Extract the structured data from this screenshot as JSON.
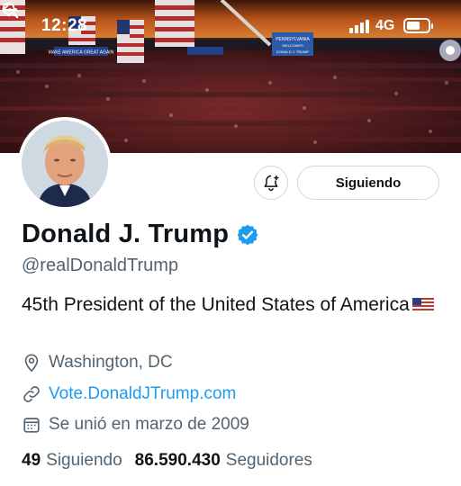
{
  "status_bar": {
    "time": "12:28",
    "network": "4G"
  },
  "banner": {
    "sign_left": "MAKE AMERICA GREAT AGAIN",
    "sign_right_top": "PENNSYLVANIA",
    "sign_right_mid": "WELCOMES",
    "sign_right_bottom": "DONALD J. TRUMP"
  },
  "profile": {
    "display_name": "Donald J. Trump",
    "handle": "@realDonaldTrump",
    "bio": "45th President of the United States of America",
    "location": "Washington, DC",
    "website": "Vote.DonaldJTrump.com",
    "joined": "Se unió en marzo de 2009",
    "following_count": "49",
    "following_label": "Siguiendo",
    "followers_count": "86.590.430",
    "followers_label": "Seguidores"
  },
  "actions": {
    "follow_state_label": "Siguiendo"
  },
  "colors": {
    "accent": "#1d9bf0",
    "secondary_text": "#536471",
    "border": "#cfd9de"
  },
  "icons": [
    "back-arrow-icon",
    "search-icon",
    "more-icon",
    "bell-plus-icon",
    "verified-badge-icon",
    "location-pin-icon",
    "link-icon",
    "calendar-icon"
  ]
}
